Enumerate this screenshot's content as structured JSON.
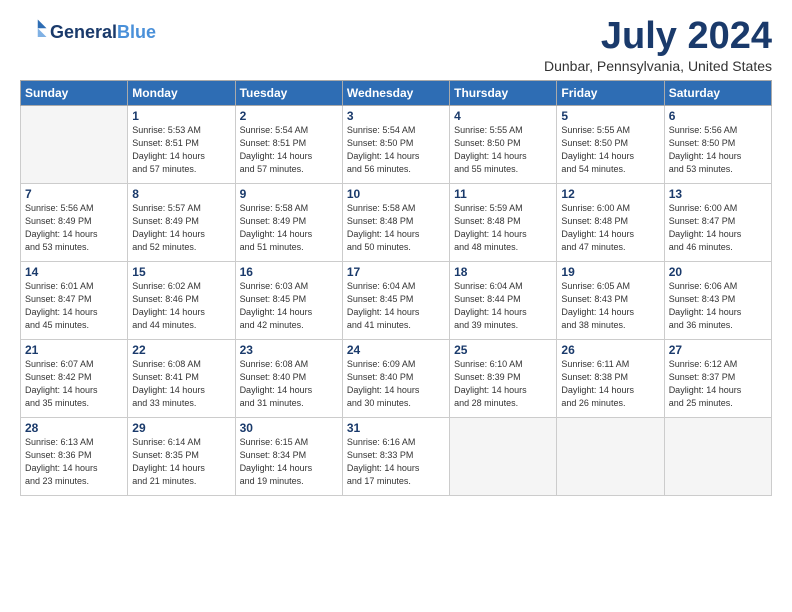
{
  "header": {
    "logo_line1": "General",
    "logo_line2": "Blue",
    "month_title": "July 2024",
    "location": "Dunbar, Pennsylvania, United States"
  },
  "weekdays": [
    "Sunday",
    "Monday",
    "Tuesday",
    "Wednesday",
    "Thursday",
    "Friday",
    "Saturday"
  ],
  "weeks": [
    [
      {
        "day": "",
        "info": ""
      },
      {
        "day": "1",
        "info": "Sunrise: 5:53 AM\nSunset: 8:51 PM\nDaylight: 14 hours\nand 57 minutes."
      },
      {
        "day": "2",
        "info": "Sunrise: 5:54 AM\nSunset: 8:51 PM\nDaylight: 14 hours\nand 57 minutes."
      },
      {
        "day": "3",
        "info": "Sunrise: 5:54 AM\nSunset: 8:50 PM\nDaylight: 14 hours\nand 56 minutes."
      },
      {
        "day": "4",
        "info": "Sunrise: 5:55 AM\nSunset: 8:50 PM\nDaylight: 14 hours\nand 55 minutes."
      },
      {
        "day": "5",
        "info": "Sunrise: 5:55 AM\nSunset: 8:50 PM\nDaylight: 14 hours\nand 54 minutes."
      },
      {
        "day": "6",
        "info": "Sunrise: 5:56 AM\nSunset: 8:50 PM\nDaylight: 14 hours\nand 53 minutes."
      }
    ],
    [
      {
        "day": "7",
        "info": "Sunrise: 5:56 AM\nSunset: 8:49 PM\nDaylight: 14 hours\nand 53 minutes."
      },
      {
        "day": "8",
        "info": "Sunrise: 5:57 AM\nSunset: 8:49 PM\nDaylight: 14 hours\nand 52 minutes."
      },
      {
        "day": "9",
        "info": "Sunrise: 5:58 AM\nSunset: 8:49 PM\nDaylight: 14 hours\nand 51 minutes."
      },
      {
        "day": "10",
        "info": "Sunrise: 5:58 AM\nSunset: 8:48 PM\nDaylight: 14 hours\nand 50 minutes."
      },
      {
        "day": "11",
        "info": "Sunrise: 5:59 AM\nSunset: 8:48 PM\nDaylight: 14 hours\nand 48 minutes."
      },
      {
        "day": "12",
        "info": "Sunrise: 6:00 AM\nSunset: 8:48 PM\nDaylight: 14 hours\nand 47 minutes."
      },
      {
        "day": "13",
        "info": "Sunrise: 6:00 AM\nSunset: 8:47 PM\nDaylight: 14 hours\nand 46 minutes."
      }
    ],
    [
      {
        "day": "14",
        "info": "Sunrise: 6:01 AM\nSunset: 8:47 PM\nDaylight: 14 hours\nand 45 minutes."
      },
      {
        "day": "15",
        "info": "Sunrise: 6:02 AM\nSunset: 8:46 PM\nDaylight: 14 hours\nand 44 minutes."
      },
      {
        "day": "16",
        "info": "Sunrise: 6:03 AM\nSunset: 8:45 PM\nDaylight: 14 hours\nand 42 minutes."
      },
      {
        "day": "17",
        "info": "Sunrise: 6:04 AM\nSunset: 8:45 PM\nDaylight: 14 hours\nand 41 minutes."
      },
      {
        "day": "18",
        "info": "Sunrise: 6:04 AM\nSunset: 8:44 PM\nDaylight: 14 hours\nand 39 minutes."
      },
      {
        "day": "19",
        "info": "Sunrise: 6:05 AM\nSunset: 8:43 PM\nDaylight: 14 hours\nand 38 minutes."
      },
      {
        "day": "20",
        "info": "Sunrise: 6:06 AM\nSunset: 8:43 PM\nDaylight: 14 hours\nand 36 minutes."
      }
    ],
    [
      {
        "day": "21",
        "info": "Sunrise: 6:07 AM\nSunset: 8:42 PM\nDaylight: 14 hours\nand 35 minutes."
      },
      {
        "day": "22",
        "info": "Sunrise: 6:08 AM\nSunset: 8:41 PM\nDaylight: 14 hours\nand 33 minutes."
      },
      {
        "day": "23",
        "info": "Sunrise: 6:08 AM\nSunset: 8:40 PM\nDaylight: 14 hours\nand 31 minutes."
      },
      {
        "day": "24",
        "info": "Sunrise: 6:09 AM\nSunset: 8:40 PM\nDaylight: 14 hours\nand 30 minutes."
      },
      {
        "day": "25",
        "info": "Sunrise: 6:10 AM\nSunset: 8:39 PM\nDaylight: 14 hours\nand 28 minutes."
      },
      {
        "day": "26",
        "info": "Sunrise: 6:11 AM\nSunset: 8:38 PM\nDaylight: 14 hours\nand 26 minutes."
      },
      {
        "day": "27",
        "info": "Sunrise: 6:12 AM\nSunset: 8:37 PM\nDaylight: 14 hours\nand 25 minutes."
      }
    ],
    [
      {
        "day": "28",
        "info": "Sunrise: 6:13 AM\nSunset: 8:36 PM\nDaylight: 14 hours\nand 23 minutes."
      },
      {
        "day": "29",
        "info": "Sunrise: 6:14 AM\nSunset: 8:35 PM\nDaylight: 14 hours\nand 21 minutes."
      },
      {
        "day": "30",
        "info": "Sunrise: 6:15 AM\nSunset: 8:34 PM\nDaylight: 14 hours\nand 19 minutes."
      },
      {
        "day": "31",
        "info": "Sunrise: 6:16 AM\nSunset: 8:33 PM\nDaylight: 14 hours\nand 17 minutes."
      },
      {
        "day": "",
        "info": ""
      },
      {
        "day": "",
        "info": ""
      },
      {
        "day": "",
        "info": ""
      }
    ]
  ]
}
